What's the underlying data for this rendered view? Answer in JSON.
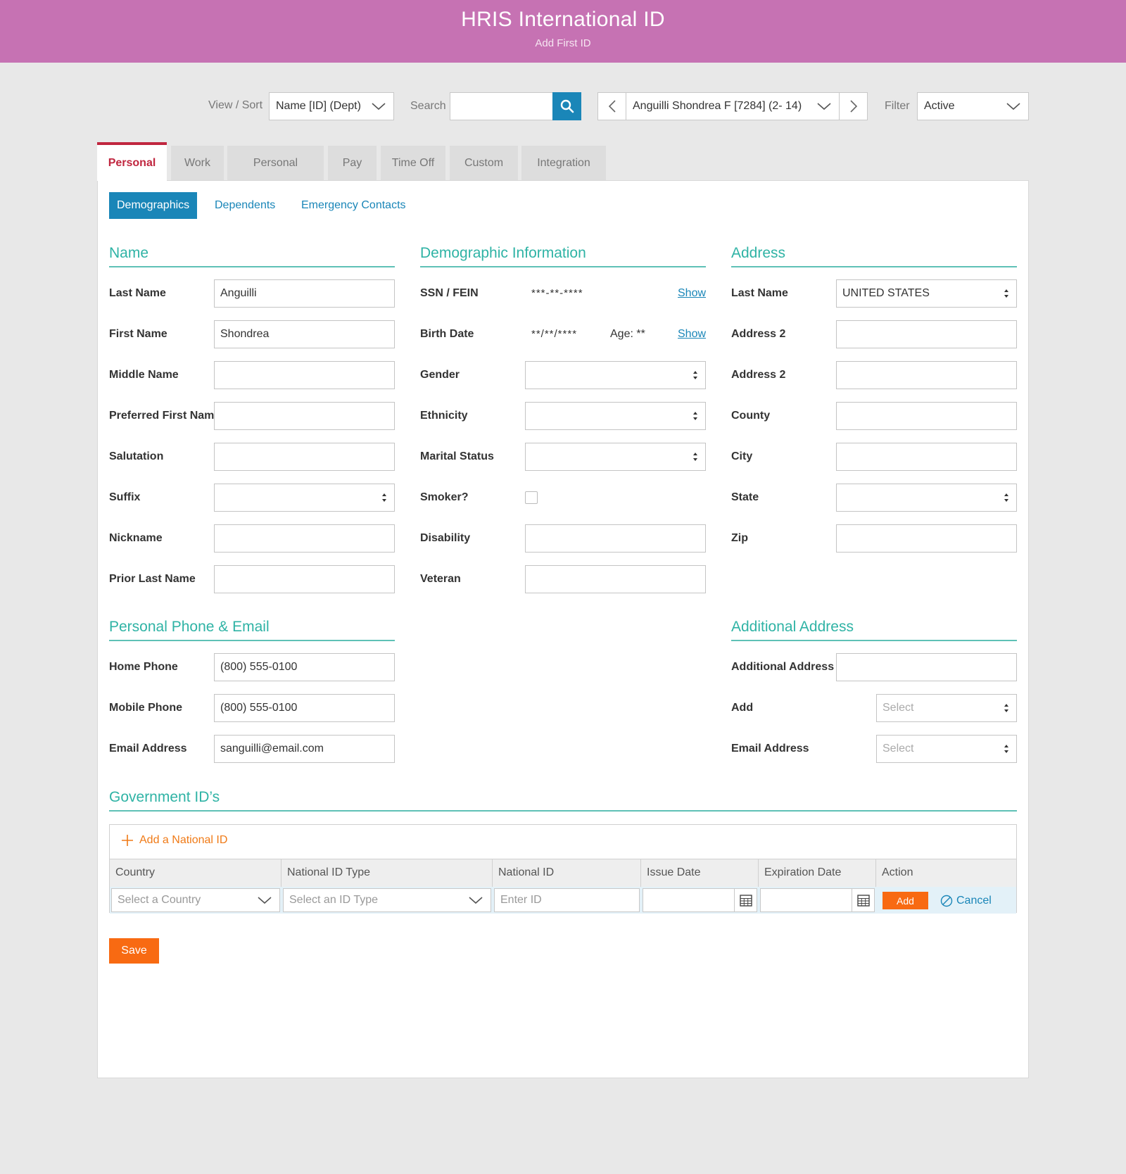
{
  "header": {
    "title": "HRIS International ID",
    "subtitle": "Add First ID"
  },
  "toolbar": {
    "view_sort_label": "View / Sort",
    "view_sort_value": "Name [ID] (Dept)",
    "search_label": "Search",
    "search_value": "",
    "employee_value": "Anguilli Shondrea F [7284] (2- 14)",
    "filter_label": "Filter",
    "filter_value": "Active"
  },
  "tabs": [
    "Personal",
    "Work",
    "Personal",
    "Pay",
    "Time Off",
    "Custom",
    "Integration"
  ],
  "subtabs": [
    "Demographics",
    "Dependents",
    "Emergency Contacts"
  ],
  "name_section": {
    "title": "Name",
    "fields": [
      {
        "label": "Last Name",
        "value": "Anguilli"
      },
      {
        "label": "First Name",
        "value": "Shondrea"
      },
      {
        "label": "Middle Name",
        "value": ""
      },
      {
        "label": "Preferred First Nam",
        "value": ""
      },
      {
        "label": "Salutation",
        "value": ""
      },
      {
        "label": "Suffix",
        "value": ""
      },
      {
        "label": "Nickname",
        "value": ""
      },
      {
        "label": "Prior Last Name",
        "value": ""
      }
    ]
  },
  "demo_section": {
    "title": "Demographic Information",
    "ssn_label": "SSN / FEIN",
    "ssn_value": "***-**-****",
    "birth_label": "Birth Date",
    "birth_value": "**/**/****",
    "age_text": "Age: **",
    "show_label": "Show",
    "gender_label": "Gender",
    "ethnicity_label": "Ethnicity",
    "marital_label": "Marital Status",
    "smoker_label": "Smoker?",
    "smoker_checked": false,
    "disability_label": "Disability",
    "veteran_label": "Veteran"
  },
  "address_section": {
    "title": "Address",
    "fields": [
      {
        "label": "Last Name",
        "value": "UNITED STATES"
      },
      {
        "label": "Address 2",
        "value": ""
      },
      {
        "label": "Address 2",
        "value": ""
      },
      {
        "label": "County",
        "value": ""
      },
      {
        "label": "City",
        "value": ""
      },
      {
        "label": "State",
        "value": ""
      },
      {
        "label": "Zip",
        "value": ""
      }
    ]
  },
  "phone_section": {
    "title": "Personal Phone & Email",
    "fields": [
      {
        "label": "Home Phone",
        "value": "(800) 555-0100"
      },
      {
        "label": "Mobile Phone",
        "value": "(800) 555-0100"
      },
      {
        "label": "Email Address",
        "value": "sanguilli@email.com"
      }
    ]
  },
  "additional_section": {
    "title": "Additional Address",
    "fields": [
      {
        "label": "Additional Address",
        "value": ""
      },
      {
        "label": "Add",
        "placeholder": "Select"
      },
      {
        "label": "Email Address",
        "placeholder": "Select"
      }
    ]
  },
  "gov_section": {
    "title": "Government ID’s",
    "add_label": "Add a National ID",
    "columns": [
      "Country",
      "National ID Type",
      "National ID",
      "Issue Date",
      "Expiration Date",
      "Action"
    ],
    "country_placeholder": "Select a Country",
    "type_placeholder": "Select an ID Type",
    "id_placeholder": "Enter ID",
    "add_button": "Add",
    "cancel_button": "Cancel"
  },
  "save_label": "Save",
  "colors": {
    "header": "#c672b3",
    "accent": "#1a86b8",
    "section": "#2fb3a5",
    "orange": "#f86a12",
    "tab_active": "#c0263f"
  }
}
